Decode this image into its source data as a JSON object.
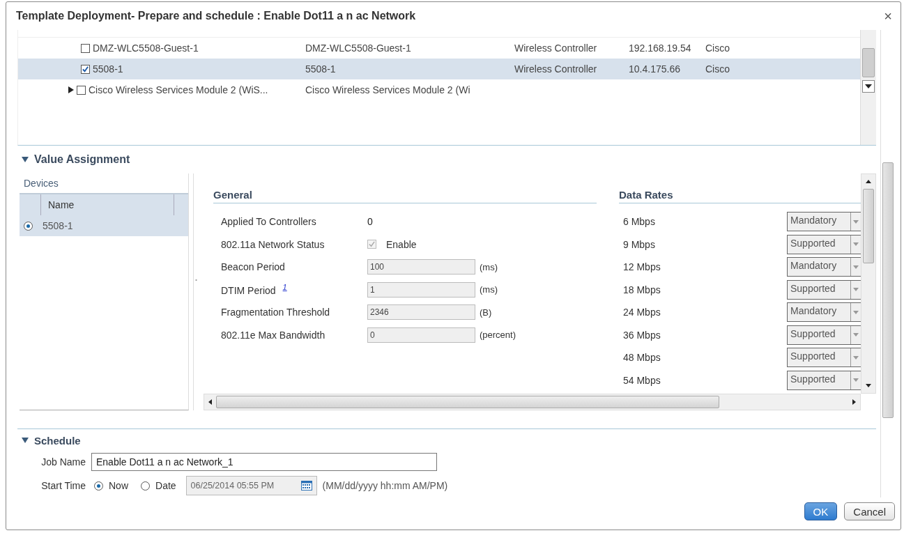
{
  "window": {
    "title": "Template Deployment- Prepare and schedule : Enable Dot11 a n ac Network",
    "close": "×"
  },
  "device_tree": {
    "rows": [
      {
        "kind": "device",
        "checked": false,
        "selected": false,
        "name": "DMZ-WLC5508-Guest-1",
        "column_2": "DMZ-WLC5508-Guest-1",
        "type": "Wireless Controller",
        "ip": "192.168.19.54",
        "vendor": "Cisco"
      },
      {
        "kind": "device",
        "checked": true,
        "selected": true,
        "name": "5508-1",
        "column_2": "5508-1",
        "type": "Wireless Controller",
        "ip": "10.4.175.66",
        "vendor": "Cisco"
      },
      {
        "kind": "group",
        "checked": false,
        "selected": false,
        "expanded": false,
        "name": "Cisco Wireless Services Module 2 (WiS...",
        "column_2": "Cisco Wireless Services Module 2 (Wi"
      }
    ]
  },
  "value_assignment": {
    "title": "Value Assignment",
    "expanded": true,
    "devices": {
      "title": "Devices",
      "column": "Name",
      "rows": [
        {
          "name": "5508-1",
          "selected": true
        }
      ]
    },
    "general": {
      "title": "General",
      "fields": [
        {
          "kind": "text",
          "label": "Applied To Controllers",
          "value": "0"
        },
        {
          "kind": "checkbox",
          "label": "802.11a Network Status",
          "checked": true,
          "disabled": true,
          "text": "Enable"
        },
        {
          "kind": "input",
          "label": "Beacon Period",
          "value": "100",
          "unit": "(ms)"
        },
        {
          "kind": "input",
          "label": "DTIM Period",
          "note": "1",
          "value": "1",
          "unit": "(ms)"
        },
        {
          "kind": "input",
          "label": "Fragmentation Threshold",
          "value": "2346",
          "unit": "(B)"
        },
        {
          "kind": "input",
          "label": "802.11e Max Bandwidth",
          "value": "0",
          "unit": "(percent)"
        }
      ]
    },
    "data_rates": {
      "title": "Data Rates",
      "rows": [
        {
          "label": "6 Mbps",
          "value": "Mandatory"
        },
        {
          "label": "9 Mbps",
          "value": "Supported"
        },
        {
          "label": "12 Mbps",
          "value": "Mandatory"
        },
        {
          "label": "18 Mbps",
          "value": "Supported"
        },
        {
          "label": "24 Mbps",
          "value": "Mandatory"
        },
        {
          "label": "36 Mbps",
          "value": "Supported"
        },
        {
          "label": "48 Mbps",
          "value": "Supported"
        },
        {
          "label": "54 Mbps",
          "value": "Supported"
        }
      ]
    }
  },
  "schedule": {
    "title": "Schedule",
    "expanded": true,
    "job_name_label": "Job Name",
    "job_name": "Enable Dot11 a n ac Network_1",
    "start_time_label": "Start Time",
    "options": [
      {
        "label": "Now",
        "selected": true
      },
      {
        "label": "Date",
        "selected": false
      }
    ],
    "date": "06/25/2014 05:55 PM",
    "date_format": "(MM/dd/yyyy hh:mm AM/PM)"
  },
  "buttons": [
    {
      "kind": "primary",
      "label": "OK"
    },
    {
      "kind": "secondary",
      "label": "Cancel"
    }
  ]
}
